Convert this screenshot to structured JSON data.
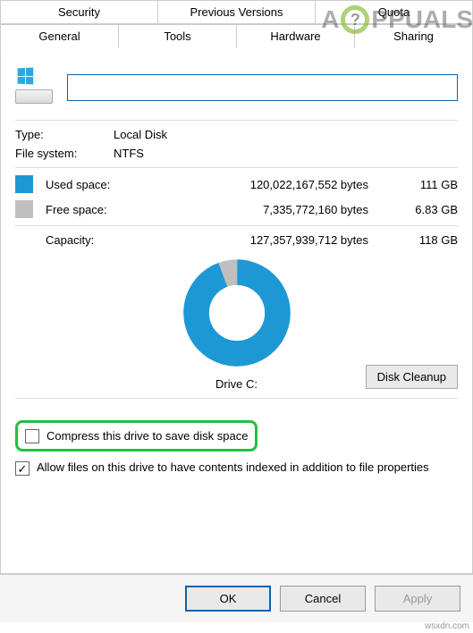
{
  "tabs": {
    "row1": [
      "Security",
      "Previous Versions",
      "Quota"
    ],
    "row2": [
      "General",
      "Tools",
      "Hardware",
      "Sharing"
    ],
    "active": "General"
  },
  "name_value": "",
  "type_label": "Type:",
  "type_value": "Local Disk",
  "fs_label": "File system:",
  "fs_value": "NTFS",
  "used_label": "Used space:",
  "used_bytes": "120,022,167,552 bytes",
  "used_gb": "111 GB",
  "free_label": "Free space:",
  "free_bytes": "7,335,772,160 bytes",
  "free_gb": "6.83 GB",
  "capacity_label": "Capacity:",
  "capacity_bytes": "127,357,939,712 bytes",
  "capacity_gb": "118 GB",
  "drive_label": "Drive C:",
  "cleanup_label": "Disk Cleanup",
  "compress_label": "Compress this drive to save disk space",
  "index_label": "Allow files on this drive to have contents indexed in addition to file properties",
  "ok_label": "OK",
  "cancel_label": "Cancel",
  "apply_label": "Apply",
  "watermark_text_a": "A",
  "watermark_text_b": "PPUALS",
  "source_mark": "wsxdn.com",
  "colors": {
    "used": "#1e98d5",
    "free": "#bfbfbf",
    "accent": "#0a64ad",
    "highlight": "#21c043"
  },
  "chart_data": {
    "type": "pie",
    "title": "Drive C:",
    "categories": [
      "Used space",
      "Free space"
    ],
    "values": [
      120022167552,
      7335772160
    ],
    "series": [
      {
        "name": "Used space",
        "bytes": 120022167552,
        "display_bytes": "120,022,167,552 bytes",
        "display_gb": "111 GB",
        "color": "#1e98d5"
      },
      {
        "name": "Free space",
        "bytes": 7335772160,
        "display_bytes": "7,335,772,160 bytes",
        "display_gb": "6.83 GB",
        "color": "#bfbfbf"
      }
    ],
    "total": {
      "bytes": 127357939712,
      "display_bytes": "127,357,939,712 bytes",
      "display_gb": "118 GB"
    }
  }
}
